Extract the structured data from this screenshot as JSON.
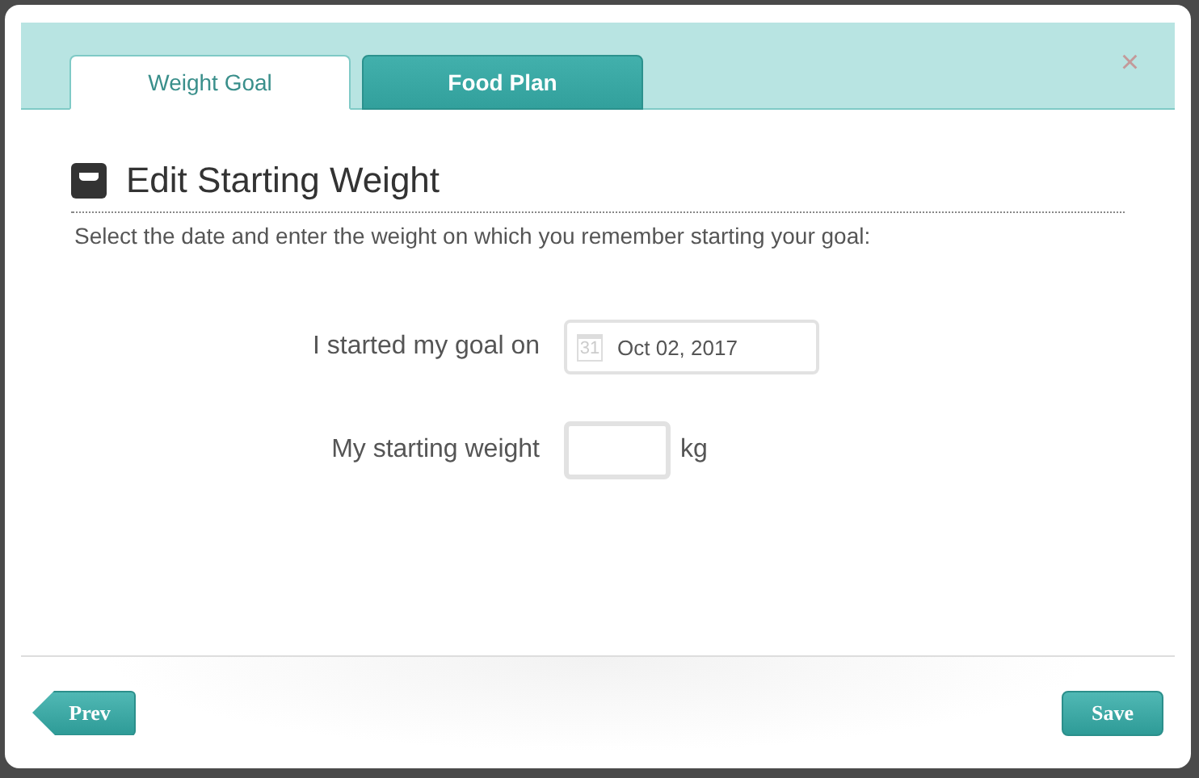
{
  "tabs": [
    {
      "label": "Weight Goal",
      "selected": true
    },
    {
      "label": "Food Plan",
      "selected": false
    }
  ],
  "close": "×",
  "heading": "Edit Starting Weight",
  "instructions": "Select the date and enter the weight on which you remember starting your goal:",
  "date_row": {
    "label": "I started my goal on",
    "calendar_day": "31",
    "value": "Oct 02, 2017"
  },
  "weight_row": {
    "label": "My starting weight",
    "unit": "kg"
  },
  "buttons": {
    "prev": "Prev",
    "save": "Save"
  }
}
